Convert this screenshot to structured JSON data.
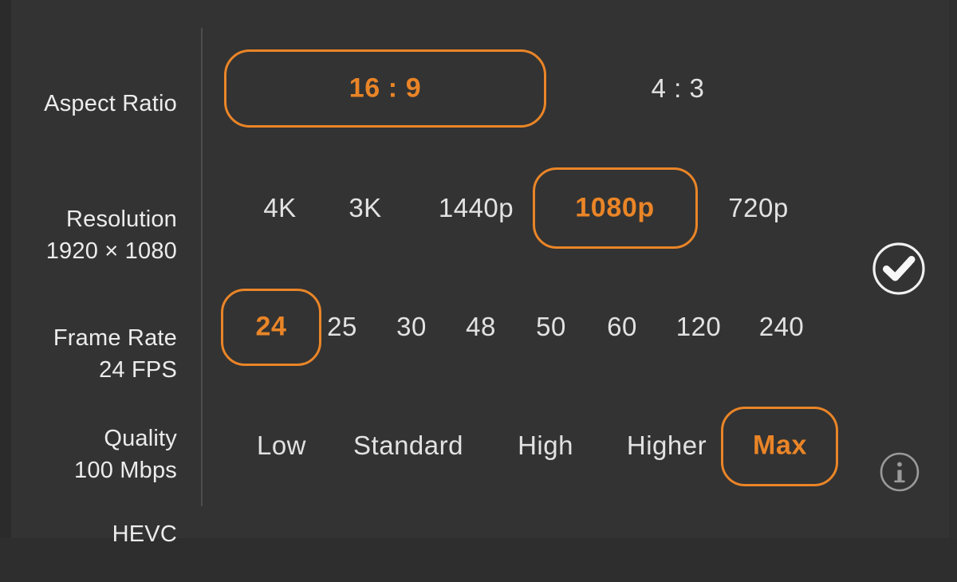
{
  "theme": {
    "background": "#333333",
    "accent": "#ea8527",
    "text": "#e2e2e2",
    "divider": "#4d4d4d",
    "icon_active": "#f2f2f2",
    "icon_muted": "#9a9a9a"
  },
  "rows": [
    {
      "id": "aspect-ratio",
      "label": "Aspect Ratio",
      "sublabels": [],
      "selected_index": 0,
      "options": [
        {
          "label": "16 : 9",
          "selected": true
        },
        {
          "label": "4 : 3",
          "selected": false
        }
      ]
    },
    {
      "id": "resolution",
      "label": "Resolution",
      "sublabels": [
        "1920 × 1080"
      ],
      "selected_index": 3,
      "options": [
        {
          "label": "4K",
          "selected": false
        },
        {
          "label": "3K",
          "selected": false
        },
        {
          "label": "1440p",
          "selected": false
        },
        {
          "label": "1080p",
          "selected": true
        },
        {
          "label": "720p",
          "selected": false
        }
      ]
    },
    {
      "id": "frame-rate",
      "label": "Frame Rate",
      "sublabels": [
        "24 FPS"
      ],
      "selected_index": 0,
      "options": [
        {
          "label": "24",
          "selected": true
        },
        {
          "label": "25",
          "selected": false
        },
        {
          "label": "30",
          "selected": false
        },
        {
          "label": "48",
          "selected": false
        },
        {
          "label": "50",
          "selected": false
        },
        {
          "label": "60",
          "selected": false
        },
        {
          "label": "120",
          "selected": false
        },
        {
          "label": "240",
          "selected": false
        }
      ]
    },
    {
      "id": "quality",
      "label": "Quality",
      "sublabels": [
        "100 Mbps",
        "HEVC"
      ],
      "selected_index": 4,
      "options": [
        {
          "label": "Low",
          "selected": false
        },
        {
          "label": "Standard",
          "selected": false
        },
        {
          "label": "High",
          "selected": false
        },
        {
          "label": "Higher",
          "selected": false
        },
        {
          "label": "Max",
          "selected": true
        }
      ]
    }
  ],
  "actions": {
    "confirm": {
      "icon": "check-circle-icon",
      "name": "Confirm"
    },
    "info": {
      "icon": "info-circle-icon",
      "name": "Info"
    }
  }
}
